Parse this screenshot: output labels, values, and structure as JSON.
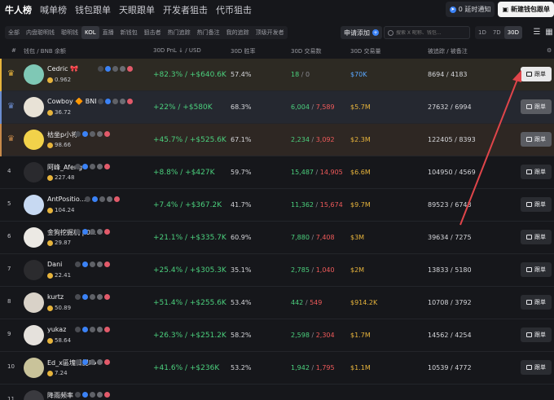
{
  "nav": {
    "tabs": [
      "牛人榜",
      "喊单榜",
      "钱包跟单",
      "天眼跟单",
      "开发者狙击",
      "代币狙击"
    ],
    "notify_label": "0 延时通知",
    "new_wallet_label": "新建钱包跟单"
  },
  "filters": {
    "chips": [
      "全部",
      "内盘聪明钱",
      "聪明钱",
      "KOL",
      "直播",
      "新钱包",
      "狙击者",
      "热门追踪",
      "热门备注",
      "我的追踪",
      "顶级开发者"
    ],
    "apply_label": "申请添加",
    "search_placeholder": "搜索 X 昵称、钱包...",
    "periods": [
      "1D",
      "7D",
      "30D"
    ],
    "view_icons": [
      "list-icon",
      "grid-icon"
    ]
  },
  "table": {
    "headers": [
      "#",
      "钱包 / BNB 余额",
      "30D PnL ↓ / USD",
      "30D 胜率",
      "30D 交易数",
      "30D 交易量",
      "被追踪 / 被备注"
    ],
    "rows": [
      {
        "rank": "1",
        "crown": "♛",
        "name": "Cedric 🎀",
        "balance": "0.962",
        "pnl": "+82.3% / +$640.6K",
        "win": "57.4%",
        "buys": "18",
        "sells": "0",
        "volume": "$70K",
        "volume_color": "#5aa8ff",
        "track": "8694 / 4183",
        "follow": "跟单"
      },
      {
        "rank": "2",
        "crown": "♛",
        "name": "Cowboy 🔶 BNB...",
        "balance": "36.72",
        "pnl": "+22% / +$580K",
        "win": "68.3%",
        "buys": "6,004",
        "sells": "7,589",
        "volume": "$5.7M",
        "volume_color": "#e7b43c",
        "track": "27632 / 6994",
        "follow": "跟单"
      },
      {
        "rank": "3",
        "crown": "♛",
        "name": "枯坐p小将",
        "balance": "98.66",
        "pnl": "+45.7% / +$525.6K",
        "win": "67.1%",
        "buys": "2,234",
        "sells": "3,092",
        "volume": "$2.3M",
        "volume_color": "#e7b43c",
        "track": "122405 / 8393",
        "follow": "跟单"
      },
      {
        "rank": "4",
        "crown": "",
        "name": "阿峰_Afeng",
        "balance": "227.48",
        "pnl": "+8.8% / +$427K",
        "win": "59.7%",
        "buys": "15,487",
        "sells": "14,905",
        "volume": "$6.6M",
        "volume_color": "#e7b43c",
        "track": "104950 / 4569",
        "follow": "跟单"
      },
      {
        "rank": "5",
        "crown": "",
        "name": "AntPositio...",
        "balance": "104.24",
        "pnl": "+7.4% / +$367.2K",
        "win": "41.7%",
        "buys": "11,362",
        "sells": "15,674",
        "volume": "$9.7M",
        "volume_color": "#e7b43c",
        "track": "89523 / 6743",
        "follow": "跟单"
      },
      {
        "rank": "6",
        "crown": "",
        "name": "金狗挖掘机 | 0x...",
        "balance": "29.87",
        "pnl": "+21.1% / +$335.7K",
        "win": "60.9%",
        "buys": "7,880",
        "sells": "7,408",
        "volume": "$3M",
        "volume_color": "#e7b43c",
        "track": "39634 / 7275",
        "follow": "跟单"
      },
      {
        "rank": "7",
        "crown": "",
        "name": "Dani",
        "balance": "22.41",
        "pnl": "+25.4% / +$305.3K",
        "win": "35.1%",
        "buys": "2,785",
        "sells": "1,040",
        "volume": "$2M",
        "volume_color": "#e7b43c",
        "track": "13833 / 5180",
        "follow": "跟单"
      },
      {
        "rank": "8",
        "crown": "",
        "name": "kurtz",
        "balance": "50.89",
        "pnl": "+51.4% / +$255.6K",
        "win": "53.4%",
        "buys": "442",
        "sells": "549",
        "volume": "$914.2K",
        "volume_color": "#e7b43c",
        "track": "10708 / 3792",
        "follow": "跟单"
      },
      {
        "rank": "9",
        "crown": "",
        "name": "yukaz",
        "balance": "58.64",
        "pnl": "+26.3% / +$251.2K",
        "win": "58.2%",
        "buys": "2,598",
        "sells": "2,304",
        "volume": "$1.7M",
        "volume_color": "#e7b43c",
        "track": "14562 / 4254",
        "follow": "跟单"
      },
      {
        "rank": "10",
        "crown": "",
        "name": "Ed_x區塊日記Hx...",
        "balance": "7.24",
        "pnl": "+41.6% / +$236K",
        "win": "53.2%",
        "buys": "1,942",
        "sells": "1,795",
        "volume": "$1.1M",
        "volume_color": "#e7b43c",
        "track": "10539 / 4772",
        "follow": "跟单"
      },
      {
        "rank": "11",
        "crown": "",
        "name": "降雨频率",
        "balance": "",
        "pnl": "",
        "win": "",
        "buys": "",
        "sells": "",
        "volume": "",
        "volume_color": "#e7b43c",
        "track": "",
        "follow": ""
      }
    ]
  },
  "colors": {
    "positive": "#4bd07d",
    "negative": "#ef5a5a",
    "gold": "#e7b43c",
    "blue": "#5aa8ff",
    "arrow": "#e0454a"
  }
}
